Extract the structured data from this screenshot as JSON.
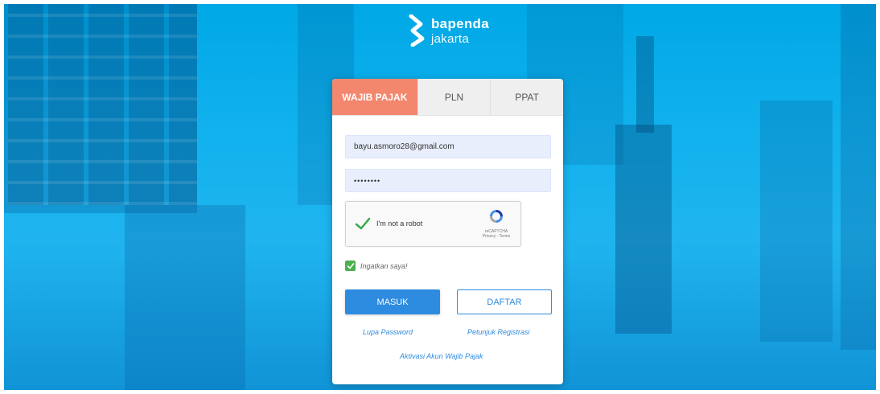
{
  "brand": {
    "name": "bapenda",
    "sub": "jakarta"
  },
  "tabs": [
    {
      "label": "WAJIB PAJAK",
      "active": true
    },
    {
      "label": "PLN",
      "active": false
    },
    {
      "label": "PPAT",
      "active": false
    }
  ],
  "form": {
    "email_value": "bayu.asmoro28@gmail.com",
    "password_value": "••••••••",
    "captcha_label": "I'm not a robot",
    "captcha_brand": "reCAPTCHA",
    "captcha_terms": "Privacy - Terms",
    "remember_label": "Ingatkan saya!",
    "remember_checked": true
  },
  "buttons": {
    "login": "MASUK",
    "register": "DAFTAR"
  },
  "links": {
    "forgot": "Lupa Password",
    "guide": "Petunjuk Registrasi",
    "activate": "Aktivasi Akun Wajib Pajak"
  },
  "colors": {
    "background": "#12b2ee",
    "active_tab": "#f2876e",
    "primary": "#2d8be0",
    "input_bg": "#e8eefc",
    "check_green": "#4caf50"
  },
  "icons": [
    "bapenda-logo-icon",
    "recaptcha-check-icon",
    "recaptcha-logo-icon",
    "checkbox-check-icon"
  ]
}
